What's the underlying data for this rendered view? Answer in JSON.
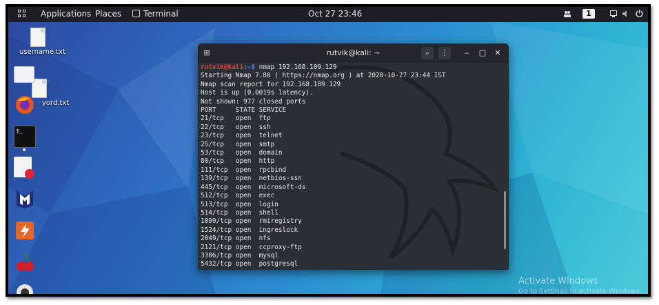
{
  "topbar": {
    "applications": "Applications",
    "places": "Places",
    "terminal": "Terminal",
    "clock": "Oct 27  23:46",
    "workspace": "1"
  },
  "desktop": {
    "files": [
      {
        "label": "username.txt"
      },
      {
        "label": "yord.txt"
      }
    ],
    "dock": [
      "files-icon",
      "firefox-icon",
      "terminal-app-icon",
      "text-editor-icon",
      "metasploit-icon",
      "burpsuite-icon",
      "cherrytree-icon",
      "camera-icon"
    ]
  },
  "terminal": {
    "title": "rutvik@kali: ~",
    "prompt_user": "rutvik@kali",
    "prompt_path": ":~$",
    "command": " nmap 192.168.109.129",
    "output": [
      "Starting Nmap 7.80 ( https://nmap.org ) at 2020-10-27 23:44 IST",
      "Nmap scan report for 192.168.109.129",
      "Host is up (0.0019s latency).",
      "Not shown: 977 closed ports",
      "PORT     STATE SERVICE",
      "21/tcp   open  ftp",
      "22/tcp   open  ssh",
      "23/tcp   open  telnet",
      "25/tcp   open  smtp",
      "53/tcp   open  domain",
      "80/tcp   open  http",
      "111/tcp  open  rpcbind",
      "139/tcp  open  netbios-ssn",
      "445/tcp  open  microsoft-ds",
      "512/tcp  open  exec",
      "513/tcp  open  login",
      "514/tcp  open  shell",
      "1099/tcp open  rmiregistry",
      "1524/tcp open  ingreslock",
      "2049/tcp open  nfs",
      "2121/tcp open  ccproxy-ftp",
      "3306/tcp open  mysql",
      "5432/tcp open  postgresql"
    ]
  },
  "watermark": {
    "line1": "Activate Windows",
    "line2": "Go to Settings to activate Windows."
  }
}
